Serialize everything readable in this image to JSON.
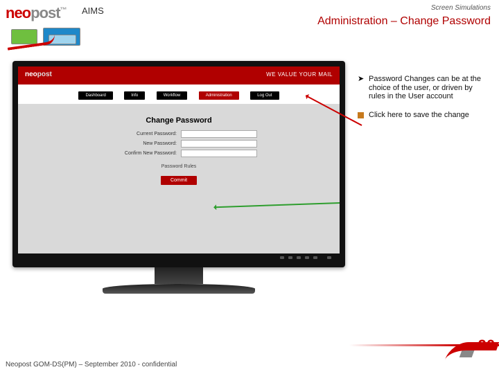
{
  "brand": {
    "a": "neo",
    "b": "post"
  },
  "product": "AIMS",
  "subhead": "Screen Simulations",
  "title": "Administration – Change Password",
  "sim": {
    "header_brand_a": "neo",
    "header_brand_b": "post",
    "header_tagline": "WE VALUE YOUR MAIL",
    "nav": {
      "dashboard": "Dashboard",
      "info": "Info",
      "workflow": "Workflow",
      "admin": "Administration",
      "logout": "Log Out"
    },
    "form": {
      "title": "Change Password",
      "row1": "Current Password:",
      "row2": "New Password:",
      "row3": "Confirm New Password:",
      "rules": "Password Rules",
      "submit": "Commit"
    }
  },
  "callouts": {
    "c1": "Password Changes can be at the choice of the user, or driven by rules in the User account",
    "c2": "Click here to save the change"
  },
  "footer": "Neopost GOM-DS(PM) – September 2010 - confidential",
  "page": "26"
}
